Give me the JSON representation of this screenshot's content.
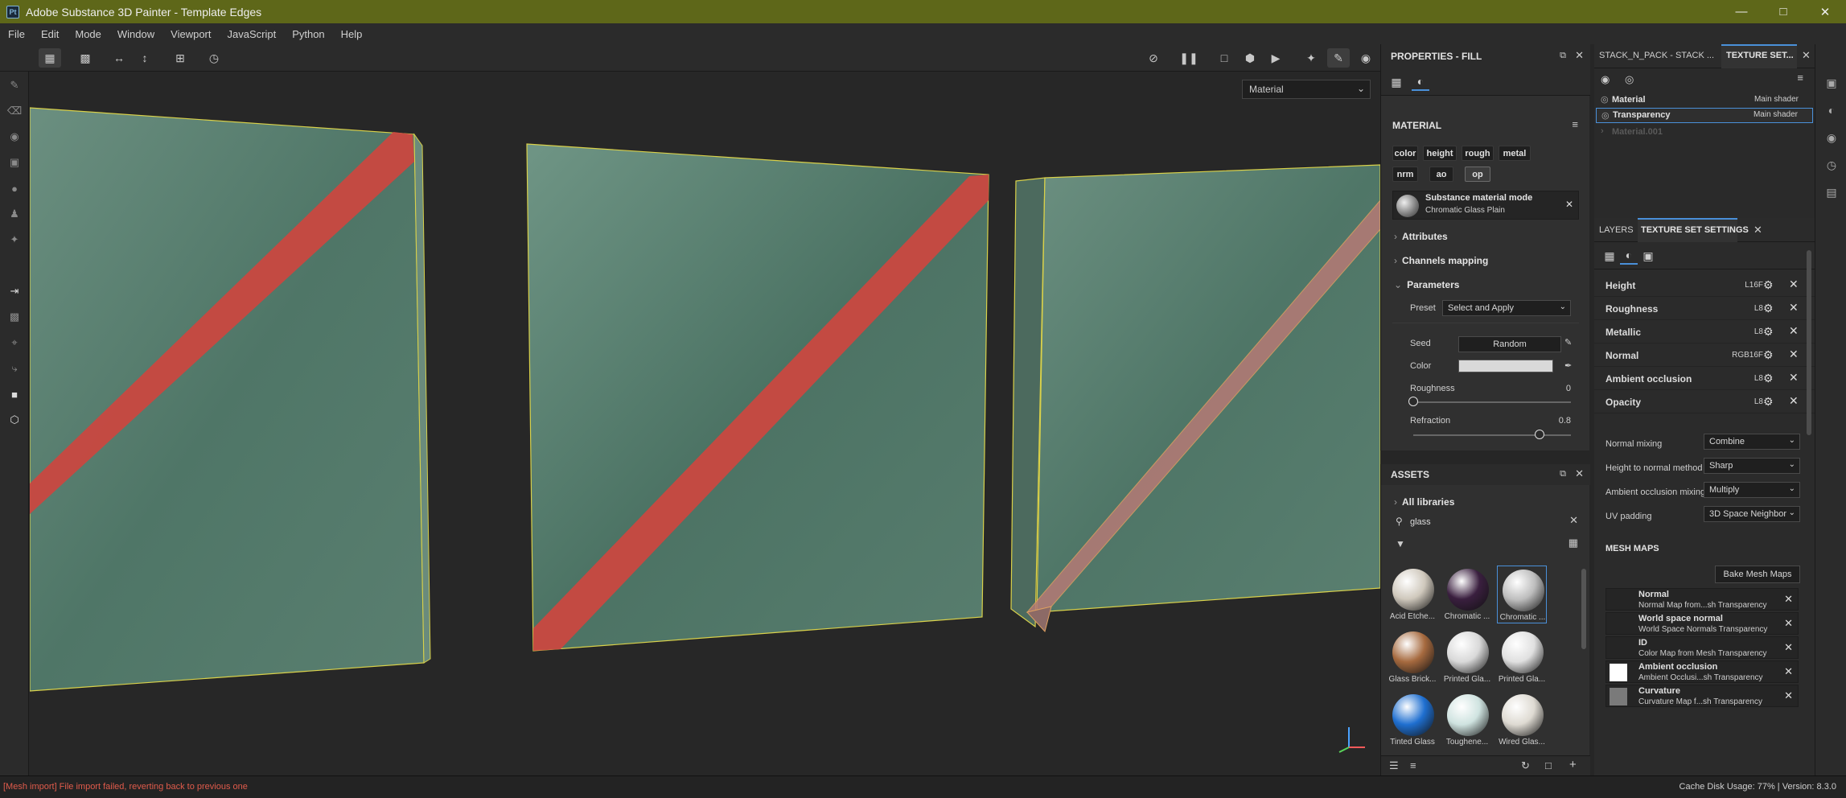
{
  "window": {
    "title": "Adobe Substance 3D Painter - Template Edges",
    "app_badge": "Pt"
  },
  "menu": [
    "File",
    "Edit",
    "Mode",
    "Window",
    "Viewport",
    "JavaScript",
    "Python",
    "Help"
  ],
  "viewport": {
    "mode_select": "Material"
  },
  "properties": {
    "title": "PROPERTIES - FILL",
    "material_header": "MATERIAL",
    "channels": [
      "color",
      "height",
      "rough",
      "metal",
      "nrm",
      "ao",
      "op"
    ],
    "selected_channel": "op",
    "material_card": {
      "title": "Substance material mode",
      "subtitle": "Chromatic Glass Plain"
    },
    "sections": {
      "attributes": "Attributes",
      "channels_mapping": "Channels mapping",
      "parameters": "Parameters"
    },
    "preset_label": "Preset",
    "preset_value": "Select and Apply",
    "seed_label": "Seed",
    "seed_value": "Random",
    "color_label": "Color",
    "roughness_label": "Roughness",
    "roughness_value": "0",
    "roughness_level": 0,
    "refraction_label": "Refraction",
    "refraction_value": "0.8",
    "refraction_level": 0.8
  },
  "assets": {
    "title": "ASSETS",
    "library": "All libraries",
    "search_value": "glass",
    "items": [
      {
        "name": "Acid Etche...",
        "color": "#cfc8bc"
      },
      {
        "name": "Chromatic ...",
        "color": "#3a1f3f"
      },
      {
        "name": "Chromatic ...",
        "color": "#bdbdbd"
      },
      {
        "name": "Glass Brick...",
        "color": "#a66a3f"
      },
      {
        "name": "Printed Gla...",
        "color": "#d9d9d9"
      },
      {
        "name": "Printed Gla...",
        "color": "#e0e0e0"
      },
      {
        "name": "Tinted Glass",
        "color": "#1f6fd0"
      },
      {
        "name": "Toughene...",
        "color": "#cfe3e0"
      },
      {
        "name": "Wired Glas...",
        "color": "#dedad2"
      }
    ],
    "selected_index": 2
  },
  "stack": {
    "tabs": [
      "STACK_N_PACK - STACK ...",
      "TEXTURE SET..."
    ],
    "rows": [
      {
        "name": "Material",
        "shader": "Main shader"
      },
      {
        "name": "Transparency",
        "shader": "Main shader"
      },
      {
        "name": "Material.001",
        "shader": ""
      }
    ]
  },
  "tss": {
    "tabs": [
      "LAYERS",
      "TEXTURE SET SETTINGS"
    ],
    "channels": [
      {
        "name": "Height",
        "format": "L16F"
      },
      {
        "name": "Roughness",
        "format": "L8"
      },
      {
        "name": "Metallic",
        "format": "L8"
      },
      {
        "name": "Normal",
        "format": "RGB16F"
      },
      {
        "name": "Ambient occlusion",
        "format": "L8"
      },
      {
        "name": "Opacity",
        "format": "L8"
      }
    ],
    "normal_mixing_label": "Normal mixing",
    "normal_mixing_value": "Combine",
    "height_method_label": "Height to normal method",
    "height_method_value": "Sharp",
    "ao_mixing_label": "Ambient occlusion mixing",
    "ao_mixing_value": "Multiply",
    "uv_padding_label": "UV padding",
    "uv_padding_value": "3D Space Neighbor",
    "mesh_maps_header": "MESH MAPS",
    "bake_button": "Bake Mesh Maps",
    "mesh_maps": [
      {
        "name": "Normal",
        "desc": "Normal Map from...sh Transparency",
        "swatch": ""
      },
      {
        "name": "World space normal",
        "desc": "World Space Normals Transparency",
        "swatch": ""
      },
      {
        "name": "ID",
        "desc": "Color Map from Mesh Transparency",
        "swatch": ""
      },
      {
        "name": "Ambient occlusion",
        "desc": "Ambient Occlusi...sh Transparency",
        "swatch": "#ffffff"
      },
      {
        "name": "Curvature",
        "desc": "Curvature Map f...sh Transparency",
        "swatch": "#7a7a7a"
      }
    ]
  },
  "status": {
    "error": "[Mesh import] File import failed, reverting back to previous one",
    "cache": "Cache Disk Usage:   77% | Version: 8.3.0"
  }
}
